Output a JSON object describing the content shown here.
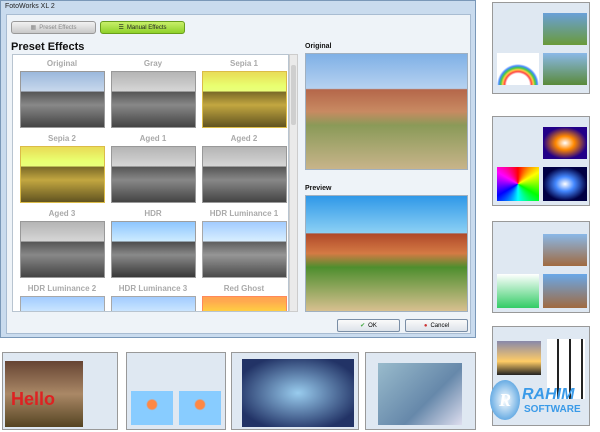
{
  "window": {
    "title": "FotoWorks XL 2"
  },
  "tabs": [
    {
      "label": "Preset Effects",
      "icon": "grid-icon"
    },
    {
      "label": "Manual Effects",
      "icon": "sliders-icon"
    }
  ],
  "preset_heading": "Preset Effects",
  "effects": [
    "Original",
    "Gray",
    "Sepia 1",
    "Sepia 2",
    "Aged 1",
    "Aged 2",
    "Aged 3",
    "HDR",
    "HDR Luminance 1",
    "HDR Luminance 2",
    "HDR Luminance 3",
    "Red Ghost"
  ],
  "original_label": "Original",
  "preview_label": "Preview",
  "buttons": {
    "ok": "OK",
    "cancel": "Cancel"
  },
  "thumbnail_text": {
    "hello": "Hello"
  },
  "watermark": {
    "line1": "RAHIM",
    "line2": "SOFTWARE"
  },
  "colors": {
    "manual_tab": "#9bd836",
    "window": "#c9dbee"
  }
}
